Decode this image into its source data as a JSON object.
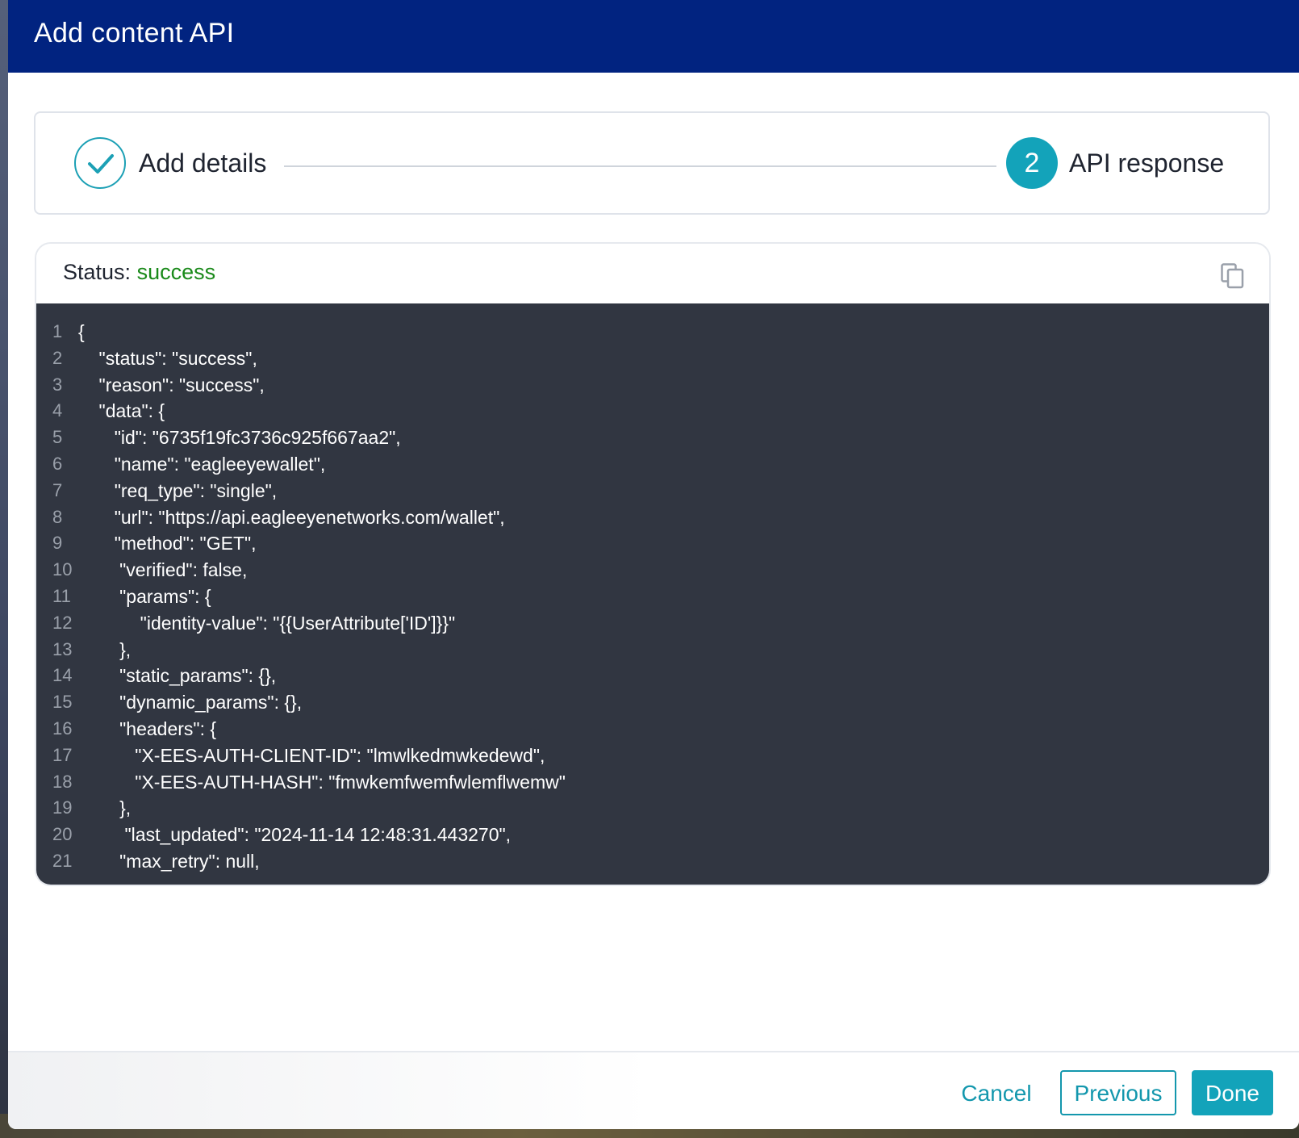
{
  "modal": {
    "title": "Add content API"
  },
  "stepper": {
    "steps": [
      {
        "label": "Add details",
        "state": "completed"
      },
      {
        "number": "2",
        "label": "API response",
        "state": "active"
      }
    ]
  },
  "response": {
    "status_label": "Status:",
    "status_value": "success",
    "code_lines": [
      {
        "n": "1",
        "text": "{"
      },
      {
        "n": "2",
        "text": "    \"status\": \"success\","
      },
      {
        "n": "3",
        "text": "    \"reason\": \"success\","
      },
      {
        "n": "4",
        "text": "    \"data\": {"
      },
      {
        "n": "5",
        "text": "       \"id\": \"6735f19fc3736c925f667aa2\","
      },
      {
        "n": "6",
        "text": "       \"name\": \"eagleeyewallet\","
      },
      {
        "n": "7",
        "text": "       \"req_type\": \"single\","
      },
      {
        "n": "8",
        "text": "       \"url\": \"https://api.eagleeyenetworks.com/wallet\","
      },
      {
        "n": "9",
        "text": "       \"method\": \"GET\","
      },
      {
        "n": "10",
        "text": "        \"verified\": false,"
      },
      {
        "n": "11",
        "text": "        \"params\": {"
      },
      {
        "n": "12",
        "text": "            \"identity-value\": \"{{UserAttribute['ID']}}\""
      },
      {
        "n": "13",
        "text": "        },"
      },
      {
        "n": "14",
        "text": "        \"static_params\": {},"
      },
      {
        "n": "15",
        "text": "        \"dynamic_params\": {},"
      },
      {
        "n": "16",
        "text": "        \"headers\": {"
      },
      {
        "n": "17",
        "text": "           \"X-EES-AUTH-CLIENT-ID\": \"lmwlkedmwkedewd\","
      },
      {
        "n": "18",
        "text": "           \"X-EES-AUTH-HASH\": \"fmwkemfwemfwlemflwemw\""
      },
      {
        "n": "19",
        "text": "        },"
      },
      {
        "n": "20",
        "text": "         \"last_updated\": \"2024-11-14 12:48:31.443270\","
      },
      {
        "n": "21",
        "text": "        \"max_retry\": null,"
      }
    ]
  },
  "footer": {
    "cancel_label": "Cancel",
    "previous_label": "Previous",
    "done_label": "Done"
  },
  "colors": {
    "header_bg": "#012380",
    "accent": "#13a3ba",
    "success": "#1a8a1a",
    "code_bg": "#313641"
  },
  "icons": {
    "step_complete": "check-icon",
    "copy": "copy-icon"
  }
}
